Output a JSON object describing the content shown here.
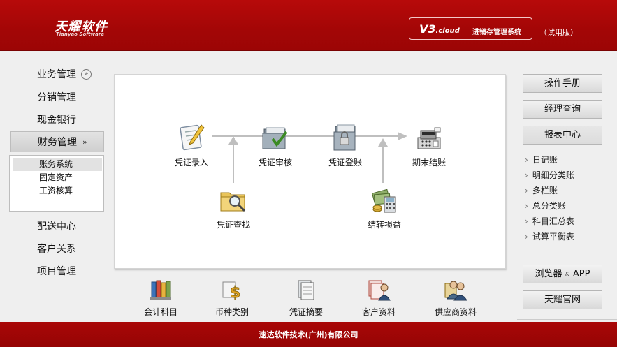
{
  "header": {
    "logo_text": "天耀软件",
    "logo_subtext": "Tianyao Software",
    "version_main": "V3",
    "version_suffix": ".cloud",
    "system_name": "进销存管理系统",
    "trial_label": "（试用版）"
  },
  "sidebar": {
    "items": [
      {
        "label": "业务管理",
        "icon": "chevron-down-circle-icon"
      },
      {
        "label": "分销管理"
      },
      {
        "label": "现金银行"
      },
      {
        "label": "财务管理",
        "icon": "chevron-double-down-icon",
        "active": true
      },
      {
        "label": "配送中心"
      },
      {
        "label": "客户关系"
      },
      {
        "label": "项目管理"
      }
    ],
    "submenu": [
      {
        "label": "账务系统",
        "selected": true
      },
      {
        "label": "固定资产"
      },
      {
        "label": "工资核算"
      }
    ]
  },
  "flow": {
    "nodes": [
      {
        "label": "凭证录入",
        "icon": "document-pen-icon"
      },
      {
        "label": "凭证审核",
        "icon": "folder-check-icon"
      },
      {
        "label": "凭证登账",
        "icon": "folder-lock-icon"
      },
      {
        "label": "期末结账",
        "icon": "cash-register-icon"
      },
      {
        "label": "凭证查找",
        "icon": "folder-search-icon"
      },
      {
        "label": "结转损益",
        "icon": "money-calculator-icon"
      }
    ]
  },
  "bottom_row": [
    {
      "label": "会计科目",
      "icon": "ledger-books-icon"
    },
    {
      "label": "币种类别",
      "icon": "currency-dollar-icon"
    },
    {
      "label": "凭证摘要",
      "icon": "documents-icon"
    },
    {
      "label": "客户资料",
      "icon": "client-cards-icon"
    },
    {
      "label": "供应商资料",
      "icon": "supplier-people-icon"
    }
  ],
  "right_panel": {
    "buttons_top": [
      "操作手册",
      "经理查询",
      "报表中心"
    ],
    "reports": [
      "日记账",
      "明细分类账",
      "多栏账",
      "总分类账",
      "科目汇总表",
      "试算平衡表"
    ],
    "browser_button": "浏览器",
    "browser_amp": "&",
    "browser_app": "APP",
    "website_button": "天耀官网"
  },
  "footer": {
    "company": "速达软件技术(广州)有限公司"
  },
  "colors": {
    "brand_red": "#a30606",
    "arrow_gray": "#bfbfbf"
  }
}
